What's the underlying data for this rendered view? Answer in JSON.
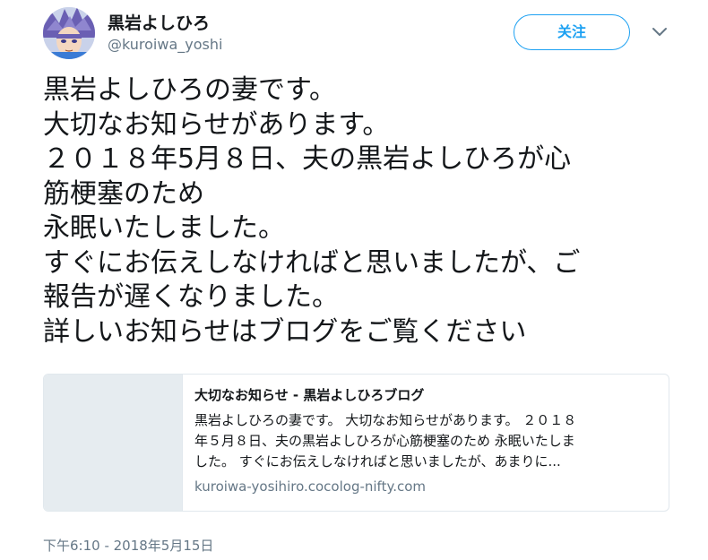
{
  "user": {
    "name": "黒岩よしひろ",
    "handle": "@kuroiwa_yoshi",
    "avatar_icon": "anime-character-avatar"
  },
  "actions": {
    "follow_label": "关注",
    "more_icon": "chevron-down-icon",
    "accent_color": "#1da1f2"
  },
  "tweet": {
    "lines": [
      "黒岩よしひろの妻です。",
      "大切なお知らせがあります。",
      "２０１８年5月８日、夫の黒岩よしひろが心",
      "筋梗塞のため",
      "永眠いたしました。",
      "すぐにお伝えしなければと思いましたが、ご",
      "報告が遅くなりました。",
      "詳しいお知らせはブログをご覧ください"
    ],
    "timestamp": "下午6:10 - 2018年5月15日"
  },
  "card": {
    "title": "大切なお知らせ - 黒岩よしひろブログ",
    "description_lines": [
      "黒岩よしひろの妻です。 大切なお知らせがあります。 ２０１８",
      "年５月８日、夫の黒岩よしひろが心筋梗塞のため 永眠いたしま",
      "した。 すぐにお伝えしなければと思いましたが、あまりに..."
    ],
    "domain": "kuroiwa-yosihiro.cocolog-nifty.com"
  }
}
